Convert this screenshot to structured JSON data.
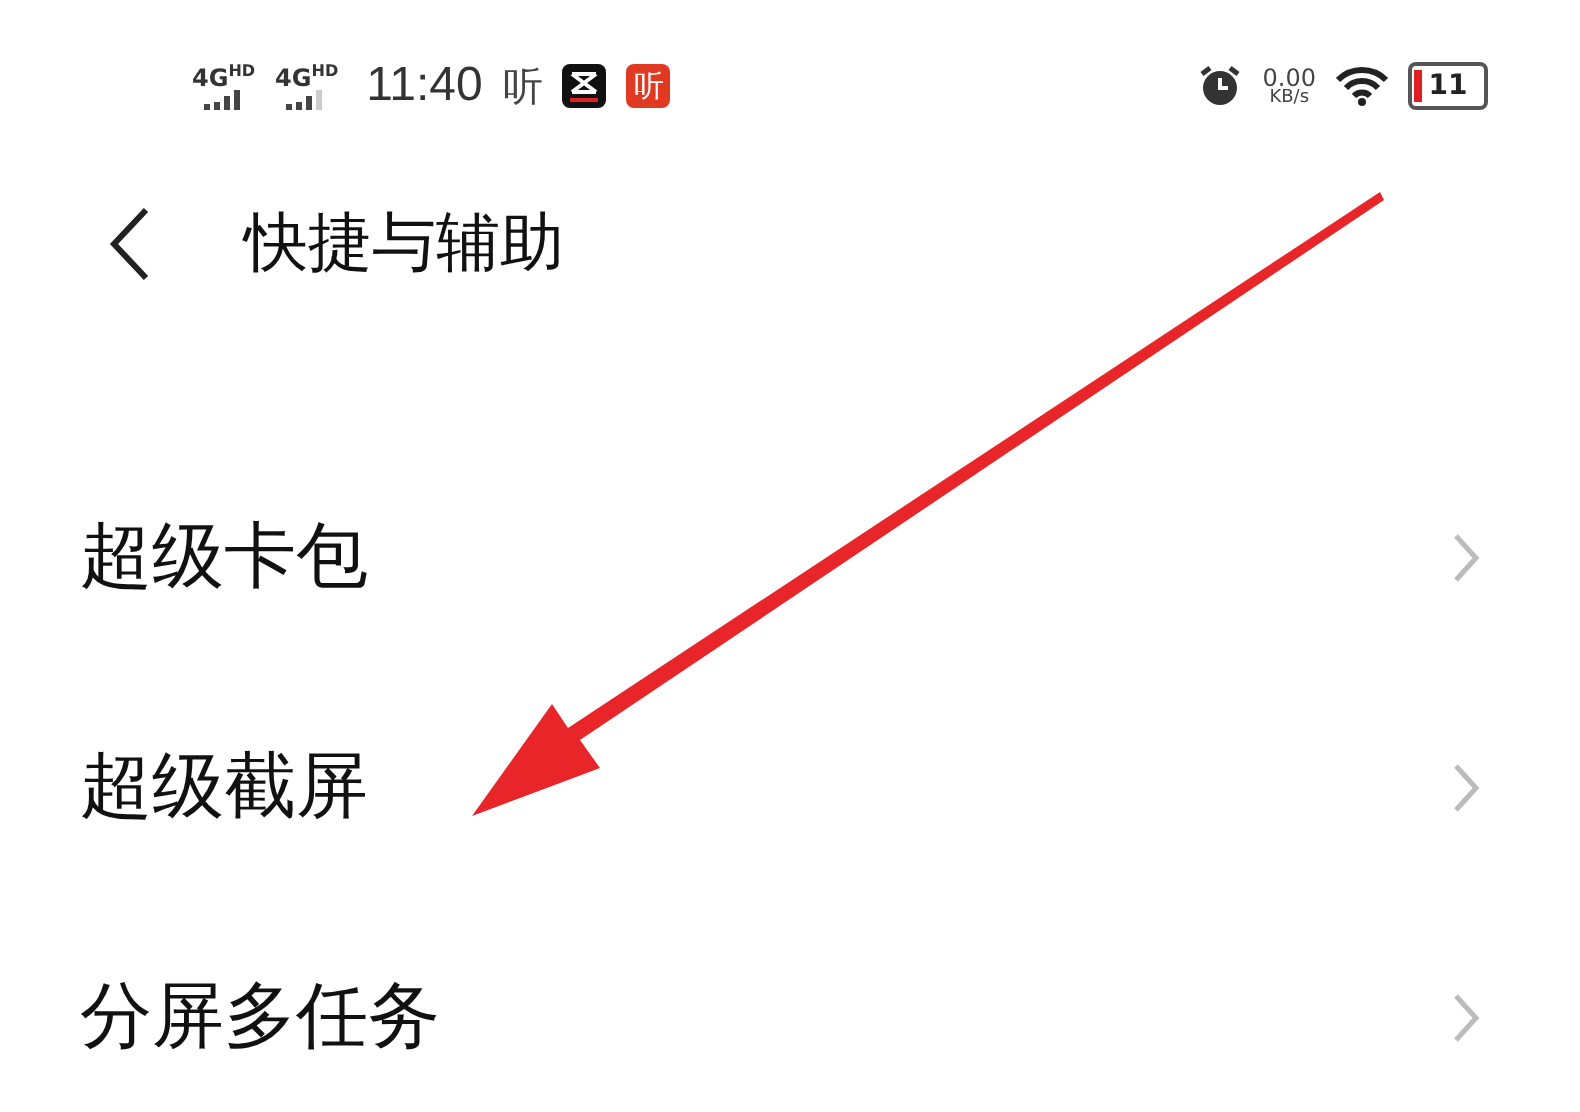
{
  "status_bar": {
    "signals": [
      {
        "label": "4G$^{HD}$"
      },
      {
        "label": "4G$^{HD}$"
      }
    ],
    "time": "11:40",
    "notice_glyph": "听",
    "app_badge": "听",
    "speed_value": "0.00",
    "speed_unit": "KB/s",
    "battery": {
      "label": "11",
      "level": 0.11
    }
  },
  "header": {
    "title": "快捷与辅助"
  },
  "items": [
    {
      "label": "超级卡包"
    },
    {
      "label": "超级截屏"
    },
    {
      "label": "分屏多任务"
    }
  ],
  "annotation": {
    "kind": "arrow"
  }
}
